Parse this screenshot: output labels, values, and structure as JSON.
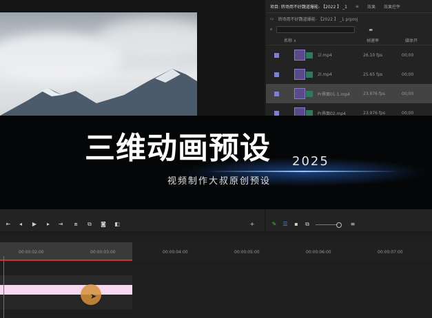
{
  "project": {
    "tabs": [
      "项目: 转场用不好魏道爆能- 【2022 】 _1",
      "≡",
      "效果",
      "效果控件"
    ],
    "path": "转场用不好魏道爆能- 【2022 】 _1 prproj",
    "search_placeholder": "",
    "columns": {
      "name": "名称 ∧",
      "fps": "帧速率",
      "media": "媒体开"
    },
    "items": [
      {
        "name": "1l.mp4",
        "fps": "26.10 fps",
        "media": "00;00",
        "selected": false
      },
      {
        "name": "2l.mp4",
        "fps": "25.65 fps",
        "media": "00;00",
        "selected": false
      },
      {
        "name": "Pr界面01-1.mp4",
        "fps": "23.976 fps",
        "media": "00;00",
        "selected": true
      },
      {
        "name": "Pr界面02.mp4",
        "fps": "23.976 fps",
        "media": "00;00",
        "selected": false
      }
    ]
  },
  "banner": {
    "title": "三维动画预设",
    "year": "2025",
    "subtitle": "视频制作大叔原创预设"
  },
  "timeline": {
    "timecodes": [
      "00:00:02:00",
      "00:00:03:00",
      "00:00:04:00",
      "00:00:05:00",
      "00:00:06:00",
      "00:00:07:00"
    ]
  },
  "colors": {
    "accent": "#3a7ae0",
    "clip": "#f6d8f1",
    "swatch": "#7d7fd6"
  },
  "icons": [
    "step-back-icon",
    "play-icon",
    "step-forward-icon",
    "camera-icon",
    "plus-icon",
    "pencil-icon",
    "list-view-icon",
    "icon-view-icon"
  ]
}
